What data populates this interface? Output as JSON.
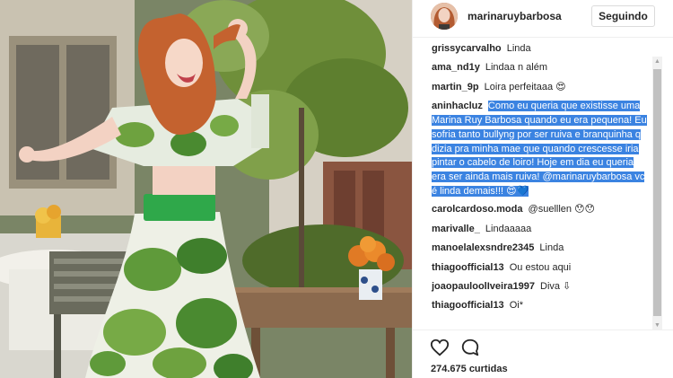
{
  "post": {
    "photo_alt": "post-photo",
    "author": {
      "username": "marinaruybarbosa",
      "follow_label": "Seguindo"
    },
    "comments": [
      {
        "user": "grissycarvalho",
        "text": "Linda"
      },
      {
        "user": "ama_nd1y",
        "text": "Lindaa n além"
      },
      {
        "user": "martin_9p",
        "text": "Loira perfeitaaa 😍"
      },
      {
        "user": "aninhacluz",
        "text": "Como eu queria que existisse uma Marina Ruy Barbosa quando eu era pequena! Eu sofria tanto bullyng por ser ruiva e branquinha q dizia pra minha mae que quando crescesse iria pintar o cabelo de loiro! Hoje em dia eu queria era ser ainda mais ruiva! @marinaruybarbosa vc é linda demais!!! 😍💙",
        "highlighted": true
      },
      {
        "user": "carolcardoso.moda",
        "text": "@suelllen 😯😯"
      },
      {
        "user": "marivalle_",
        "text": "Lindaaaaa"
      },
      {
        "user": "manoelalexsndre2345",
        "text": "Linda"
      },
      {
        "user": "thiagoofficial13",
        "text": "Ou estou aqui"
      },
      {
        "user": "joaopauloolIveira1997",
        "text": "Diva ⇩"
      },
      {
        "user": "thiagoofficial13",
        "text": "Oi*"
      }
    ],
    "likes_label": "274.675 curtidas",
    "icons": {
      "like": "heart-icon",
      "comment": "comment-bubble-icon",
      "scroll_up": "scroll-up-arrow-icon",
      "scroll_down": "scroll-down-arrow-icon"
    },
    "colors": {
      "selection": "#3b83e1",
      "border": "#efefef",
      "text": "#262626"
    }
  }
}
